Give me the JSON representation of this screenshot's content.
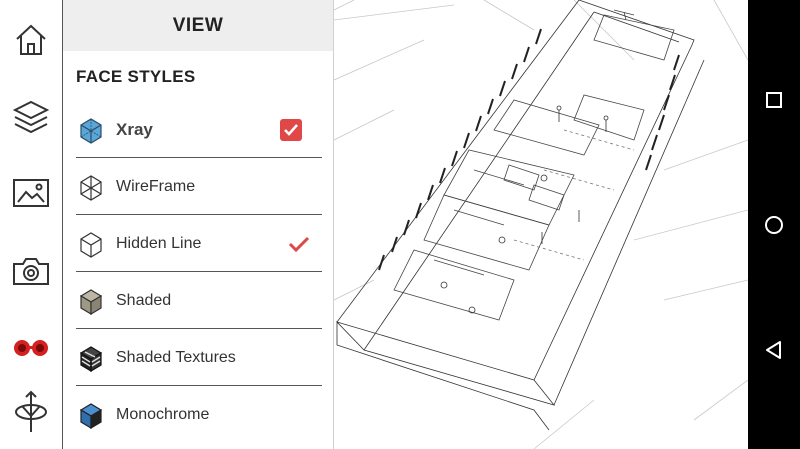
{
  "panel": {
    "title": "VIEW",
    "section_title": "FACE STYLES",
    "items": [
      {
        "label": "Xray",
        "icon": "xray-cube-icon",
        "state": "checkbox-checked"
      },
      {
        "label": "WireFrame",
        "icon": "wireframe-cube-icon",
        "state": "none"
      },
      {
        "label": "Hidden Line",
        "icon": "hidden-line-cube-icon",
        "state": "check"
      },
      {
        "label": "Shaded",
        "icon": "shaded-cube-icon",
        "state": "none"
      },
      {
        "label": "Shaded Textures",
        "icon": "shaded-textures-cube-icon",
        "state": "none"
      },
      {
        "label": "Monochrome",
        "icon": "monochrome-cube-icon",
        "state": "none"
      }
    ]
  },
  "toolbar": {
    "tools": [
      "home-icon",
      "layers-icon",
      "image-icon",
      "camera-icon",
      "vr-glasses-icon",
      "orbit-icon"
    ]
  },
  "navbar": {
    "buttons": [
      "recents-square-icon",
      "home-circle-icon",
      "back-triangle-icon"
    ]
  },
  "colors": {
    "accent": "#e04848",
    "header_bg": "#eeeeee",
    "navbar_bg": "#000000"
  }
}
